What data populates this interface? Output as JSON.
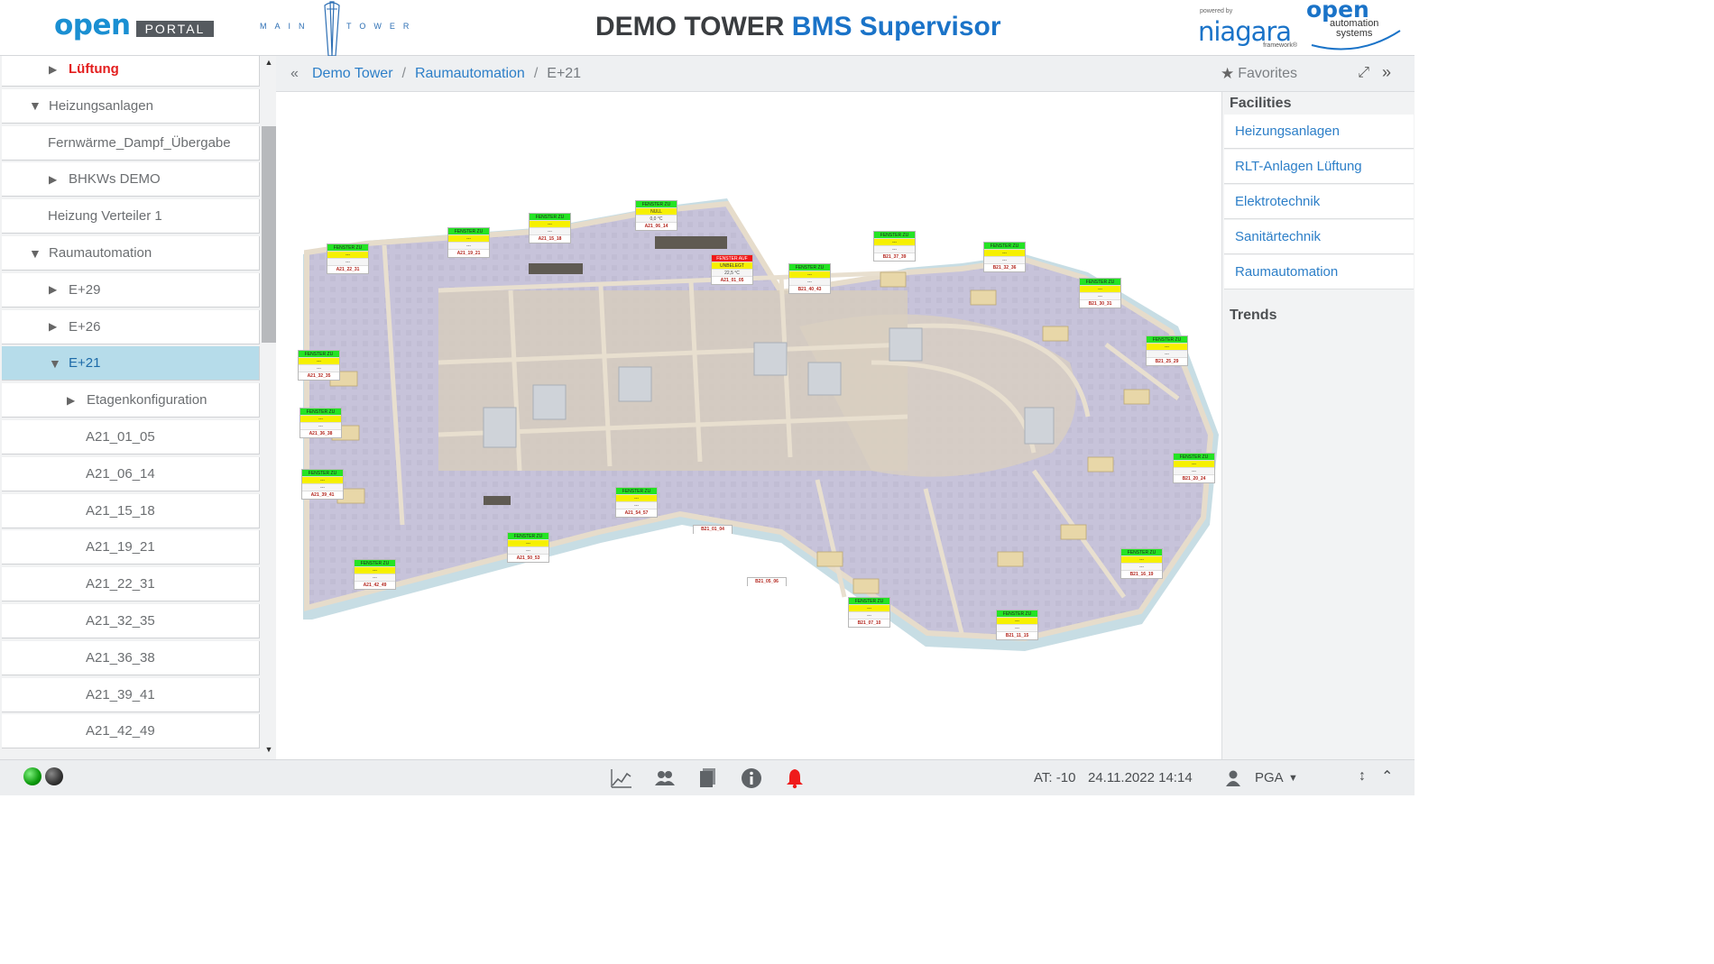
{
  "header": {
    "logo_open": "open",
    "logo_portal": "PORTAL",
    "logo_maintower": "MAIN TOWER",
    "title_main": "DEMO TOWER",
    "title_accent": "BMS Supervisor",
    "niagara_powered": "powered by",
    "niagara_name": "niagara",
    "niagara_framework": "framework®",
    "oas_open": "open",
    "oas_line1": "automation",
    "oas_line2": "systems"
  },
  "sidebar": {
    "items": [
      {
        "label": "Lüftung",
        "indent": 1,
        "arrow": "right"
      },
      {
        "label": "Heizungsanlagen",
        "indent": 0,
        "arrow": "down"
      },
      {
        "label": "Fernwärme_Dampf_Übergabe",
        "indent": 0,
        "arrow": "none"
      },
      {
        "label": "BHKWs DEMO",
        "indent": 1,
        "arrow": "right"
      },
      {
        "label": "Heizung Verteiler 1",
        "indent": 0,
        "arrow": "none"
      },
      {
        "label": "Raumautomation",
        "indent": 0,
        "arrow": "down"
      },
      {
        "label": "E+29",
        "indent": 1,
        "arrow": "right"
      },
      {
        "label": "E+26",
        "indent": 1,
        "arrow": "right"
      },
      {
        "label": "E+21",
        "indent": 1,
        "arrow": "down"
      },
      {
        "label": "Etagenkonfiguration",
        "indent": 2,
        "arrow": "right"
      },
      {
        "label": "A21_01_05",
        "indent": 2,
        "arrow": "none"
      },
      {
        "label": "A21_06_14",
        "indent": 2,
        "arrow": "none"
      },
      {
        "label": "A21_15_18",
        "indent": 2,
        "arrow": "none"
      },
      {
        "label": "A21_19_21",
        "indent": 2,
        "arrow": "none"
      },
      {
        "label": "A21_22_31",
        "indent": 2,
        "arrow": "none"
      },
      {
        "label": "A21_32_35",
        "indent": 2,
        "arrow": "none"
      },
      {
        "label": "A21_36_38",
        "indent": 2,
        "arrow": "none"
      },
      {
        "label": "A21_39_41",
        "indent": 2,
        "arrow": "none"
      },
      {
        "label": "A21_42_49",
        "indent": 2,
        "arrow": "none"
      }
    ]
  },
  "breadcrumb": {
    "items": [
      "Demo Tower",
      "Raumautomation",
      "E+21"
    ],
    "favorites_label": "Favorites"
  },
  "rpanel": {
    "facilities_title": "Facilities",
    "facilities": [
      "Heizungsanlagen",
      "RLT-Anlagen Lüftung",
      "Elektrotechnik",
      "Sanitärtechnik",
      "Raumautomation"
    ],
    "trends_title": "Trends"
  },
  "floorplan": {
    "tags": [
      {
        "lines": [
          "FENSTER ZU",
          "---",
          "---",
          "A21_22_31"
        ]
      },
      {
        "lines": [
          "FENSTER ZU",
          "---",
          "---",
          "A21_19_21"
        ]
      },
      {
        "lines": [
          "FENSTER ZU",
          "---",
          "---",
          "A21_15_18"
        ]
      },
      {
        "lines": [
          "FENSTER ZU",
          "NULL",
          "0,0 °C",
          "A21_06_14"
        ]
      },
      {
        "lines": [
          "FENSTER AUF",
          "UNBELEGT",
          "22,5 °C",
          "A21_01_05"
        ]
      },
      {
        "lines": [
          "FENSTER ZU",
          "---",
          "---",
          "B21_40_43"
        ]
      },
      {
        "lines": [
          "FENSTER ZU",
          "---",
          "---",
          "B21_37_39"
        ]
      },
      {
        "lines": [
          "FENSTER ZU",
          "---",
          "---",
          "B21_32_36"
        ]
      },
      {
        "lines": [
          "FENSTER ZU",
          "---",
          "---",
          "B21_30_31"
        ]
      },
      {
        "lines": [
          "FENSTER ZU",
          "---",
          "---",
          "B21_25_29"
        ]
      },
      {
        "lines": [
          "FENSTER ZU",
          "---",
          "---",
          "A21_32_35"
        ]
      },
      {
        "lines": [
          "FENSTER ZU",
          "---",
          "---",
          "A21_36_38"
        ]
      },
      {
        "lines": [
          "FENSTER ZU",
          "---",
          "---",
          "A21_39_41"
        ]
      },
      {
        "lines": [
          "FENSTER ZU",
          "---",
          "---",
          "A21_54_57"
        ]
      },
      {
        "lines": [
          "FENSTER ZU",
          "---",
          "---",
          "A21_50_53"
        ]
      },
      {
        "lines": [
          "FENSTER ZU",
          "---",
          "---",
          "A21_42_49"
        ]
      },
      {
        "lines": [
          "FENSTER ZU",
          "---",
          "---",
          "B21_20_24"
        ]
      },
      {
        "lines": [
          "FENSTER ZU",
          "---",
          "---",
          "B21_16_19"
        ]
      },
      {
        "lines": [
          "FENSTER ZU",
          "---",
          "---",
          "B21_07_10"
        ]
      },
      {
        "lines": [
          "FENSTER ZU",
          "---",
          "---",
          "B21_11_15"
        ]
      }
    ],
    "solo_tags": [
      "B21_01_04",
      "B21_05_06"
    ]
  },
  "footer": {
    "at_label": "AT: -10",
    "datetime": "24.11.2022 14:14",
    "user": "PGA",
    "icons": [
      "chart-icon",
      "users-icon",
      "documents-icon",
      "info-icon",
      "alarm-bell-icon"
    ]
  },
  "colors": {
    "accent": "#1a73c8",
    "active_row": "#b6dcea",
    "window_closed": "#24e324",
    "window_open": "#f01818",
    "status_yellow": "#f6f000"
  }
}
